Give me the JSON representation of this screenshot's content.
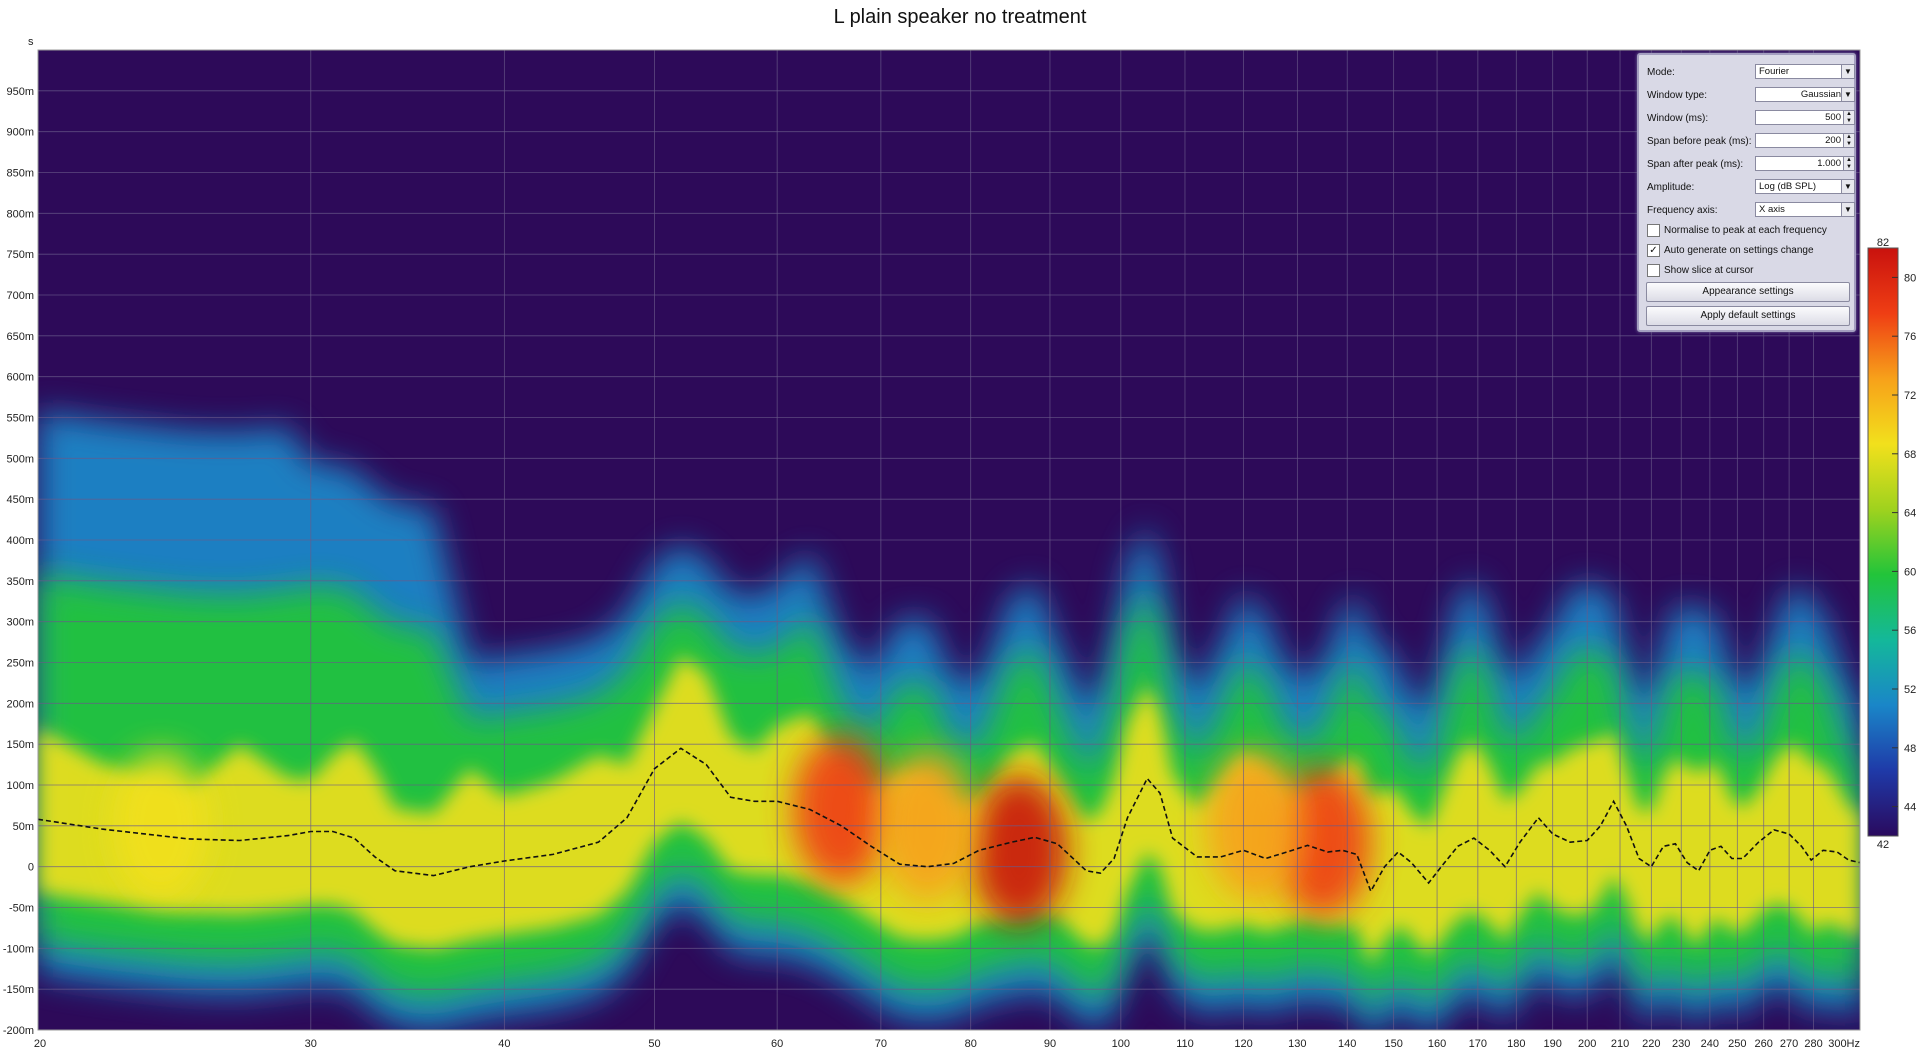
{
  "title": "L plain speaker no treatment",
  "chart_data": {
    "type": "heatmap",
    "title": "L plain speaker no treatment",
    "xlabel": "Hz",
    "ylabel": "s",
    "x_scale": "log",
    "xlim": [
      20,
      300
    ],
    "ylim": [
      -0.2,
      1.0
    ],
    "x_ticks": [
      20,
      30,
      40,
      50,
      60,
      70,
      80,
      90,
      100,
      110,
      120,
      130,
      140,
      150,
      160,
      170,
      180,
      190,
      200,
      210,
      220,
      230,
      240,
      250,
      260,
      270,
      280,
      300
    ],
    "x_tick_labels": [
      "20",
      "30",
      "40",
      "50",
      "60",
      "70",
      "80",
      "90",
      "100",
      "110",
      "120",
      "130",
      "140",
      "150",
      "160",
      "170",
      "180",
      "190",
      "200",
      "210",
      "220",
      "230",
      "240",
      "250",
      "260",
      "270",
      "280",
      "300Hz"
    ],
    "y_ticks": [
      -0.2,
      -0.15,
      -0.1,
      -0.05,
      0,
      0.05,
      0.1,
      0.15,
      0.2,
      0.25,
      0.3,
      0.35,
      0.4,
      0.45,
      0.5,
      0.55,
      0.6,
      0.65,
      0.7,
      0.75,
      0.8,
      0.85,
      0.9,
      0.95
    ],
    "y_tick_labels": [
      "-200m",
      "-150m",
      "-100m",
      "-50m",
      "0",
      "50m",
      "100m",
      "150m",
      "200m",
      "250m",
      "300m",
      "350m",
      "400m",
      "450m",
      "500m",
      "550m",
      "600m",
      "650m",
      "700m",
      "750m",
      "800m",
      "850m",
      "900m",
      "950m"
    ],
    "y_unit_label": "s",
    "colorbar": {
      "min": 42,
      "max": 82,
      "ticks": [
        44,
        48,
        52,
        56,
        60,
        64,
        68,
        72,
        76,
        80
      ],
      "min_label": "42",
      "max_label": "82",
      "colors": [
        "#2a0a5e",
        "#1f3aa8",
        "#1a86c8",
        "#14b89a",
        "#22c43a",
        "#9fd21e",
        "#f2e01c",
        "#f7a11a",
        "#ef3e14",
        "#c9120e"
      ]
    },
    "background_color": "#2d0a59",
    "peak_time_curve": [
      {
        "x": 20,
        "y": 0.058
      },
      {
        "x": 22,
        "y": 0.046
      },
      {
        "x": 25,
        "y": 0.034
      },
      {
        "x": 27,
        "y": 0.032
      },
      {
        "x": 29,
        "y": 0.038
      },
      {
        "x": 30,
        "y": 0.043
      },
      {
        "x": 31,
        "y": 0.043
      },
      {
        "x": 32,
        "y": 0.035
      },
      {
        "x": 33,
        "y": 0.012
      },
      {
        "x": 34,
        "y": -0.005
      },
      {
        "x": 36,
        "y": -0.011
      },
      {
        "x": 38,
        "y": 0.0
      },
      {
        "x": 40,
        "y": 0.007
      },
      {
        "x": 43,
        "y": 0.015
      },
      {
        "x": 46,
        "y": 0.03
      },
      {
        "x": 48,
        "y": 0.06
      },
      {
        "x": 50,
        "y": 0.12
      },
      {
        "x": 52,
        "y": 0.145
      },
      {
        "x": 54,
        "y": 0.125
      },
      {
        "x": 56,
        "y": 0.085
      },
      {
        "x": 58,
        "y": 0.08
      },
      {
        "x": 60,
        "y": 0.08
      },
      {
        "x": 63,
        "y": 0.07
      },
      {
        "x": 66,
        "y": 0.05
      },
      {
        "x": 69,
        "y": 0.025
      },
      {
        "x": 72,
        "y": 0.003
      },
      {
        "x": 75,
        "y": 0.0
      },
      {
        "x": 78,
        "y": 0.004
      },
      {
        "x": 81,
        "y": 0.02
      },
      {
        "x": 85,
        "y": 0.03
      },
      {
        "x": 88,
        "y": 0.036
      },
      {
        "x": 91,
        "y": 0.028
      },
      {
        "x": 95,
        "y": -0.005
      },
      {
        "x": 97,
        "y": -0.008
      },
      {
        "x": 99,
        "y": 0.01
      },
      {
        "x": 101,
        "y": 0.06
      },
      {
        "x": 104,
        "y": 0.108
      },
      {
        "x": 106,
        "y": 0.09
      },
      {
        "x": 108,
        "y": 0.035
      },
      {
        "x": 112,
        "y": 0.012
      },
      {
        "x": 116,
        "y": 0.012
      },
      {
        "x": 120,
        "y": 0.02
      },
      {
        "x": 124,
        "y": 0.01
      },
      {
        "x": 128,
        "y": 0.018
      },
      {
        "x": 132,
        "y": 0.026
      },
      {
        "x": 136,
        "y": 0.018
      },
      {
        "x": 139,
        "y": 0.02
      },
      {
        "x": 142,
        "y": 0.015
      },
      {
        "x": 145,
        "y": -0.03
      },
      {
        "x": 148,
        "y": 0.0
      },
      {
        "x": 151,
        "y": 0.018
      },
      {
        "x": 154,
        "y": 0.005
      },
      {
        "x": 158,
        "y": -0.02
      },
      {
        "x": 161,
        "y": 0.0
      },
      {
        "x": 165,
        "y": 0.025
      },
      {
        "x": 169,
        "y": 0.035
      },
      {
        "x": 173,
        "y": 0.02
      },
      {
        "x": 177,
        "y": 0.0
      },
      {
        "x": 181,
        "y": 0.03
      },
      {
        "x": 186,
        "y": 0.06
      },
      {
        "x": 190,
        "y": 0.04
      },
      {
        "x": 195,
        "y": 0.03
      },
      {
        "x": 200,
        "y": 0.032
      },
      {
        "x": 204,
        "y": 0.05
      },
      {
        "x": 208,
        "y": 0.08
      },
      {
        "x": 212,
        "y": 0.05
      },
      {
        "x": 216,
        "y": 0.01
      },
      {
        "x": 220,
        "y": 0.0
      },
      {
        "x": 224,
        "y": 0.025
      },
      {
        "x": 228,
        "y": 0.028
      },
      {
        "x": 232,
        "y": 0.005
      },
      {
        "x": 236,
        "y": -0.005
      },
      {
        "x": 240,
        "y": 0.02
      },
      {
        "x": 244,
        "y": 0.025
      },
      {
        "x": 248,
        "y": 0.01
      },
      {
        "x": 252,
        "y": 0.01
      },
      {
        "x": 258,
        "y": 0.03
      },
      {
        "x": 264,
        "y": 0.045
      },
      {
        "x": 270,
        "y": 0.04
      },
      {
        "x": 275,
        "y": 0.025
      },
      {
        "x": 279,
        "y": 0.008
      },
      {
        "x": 284,
        "y": 0.02
      },
      {
        "x": 290,
        "y": 0.018
      },
      {
        "x": 295,
        "y": 0.008
      },
      {
        "x": 300,
        "y": 0.005
      }
    ],
    "hotspots": [
      {
        "x": 86,
        "y": 0.02,
        "level": 82
      },
      {
        "x": 135,
        "y": 0.03,
        "level": 79
      },
      {
        "x": 122,
        "y": 0.05,
        "level": 75
      },
      {
        "x": 66,
        "y": 0.07,
        "level": 76
      },
      {
        "x": 75,
        "y": 0.05,
        "level": 74
      },
      {
        "x": 24,
        "y": 0.05,
        "level": 70
      }
    ]
  },
  "panel": {
    "mode_label": "Mode:",
    "mode_value": "Fourier",
    "window_type_label": "Window type:",
    "window_type_value": "Gaussian",
    "window_ms_label": "Window (ms):",
    "window_ms_value": "500",
    "span_before_label": "Span before peak (ms):",
    "span_before_value": "200",
    "span_after_label": "Span after peak (ms):",
    "span_after_value": "1.000",
    "amplitude_label": "Amplitude:",
    "amplitude_value": "Log (dB SPL)",
    "freq_axis_label": "Frequency axis:",
    "freq_axis_value": "X axis",
    "normalise_label": "Normalise to peak at each frequency",
    "normalise_checked": false,
    "autogen_label": "Auto generate on settings change",
    "autogen_checked": true,
    "show_slice_label": "Show slice at cursor",
    "show_slice_checked": false,
    "appearance_button": "Appearance settings",
    "apply_defaults_button": "Apply default settings"
  }
}
